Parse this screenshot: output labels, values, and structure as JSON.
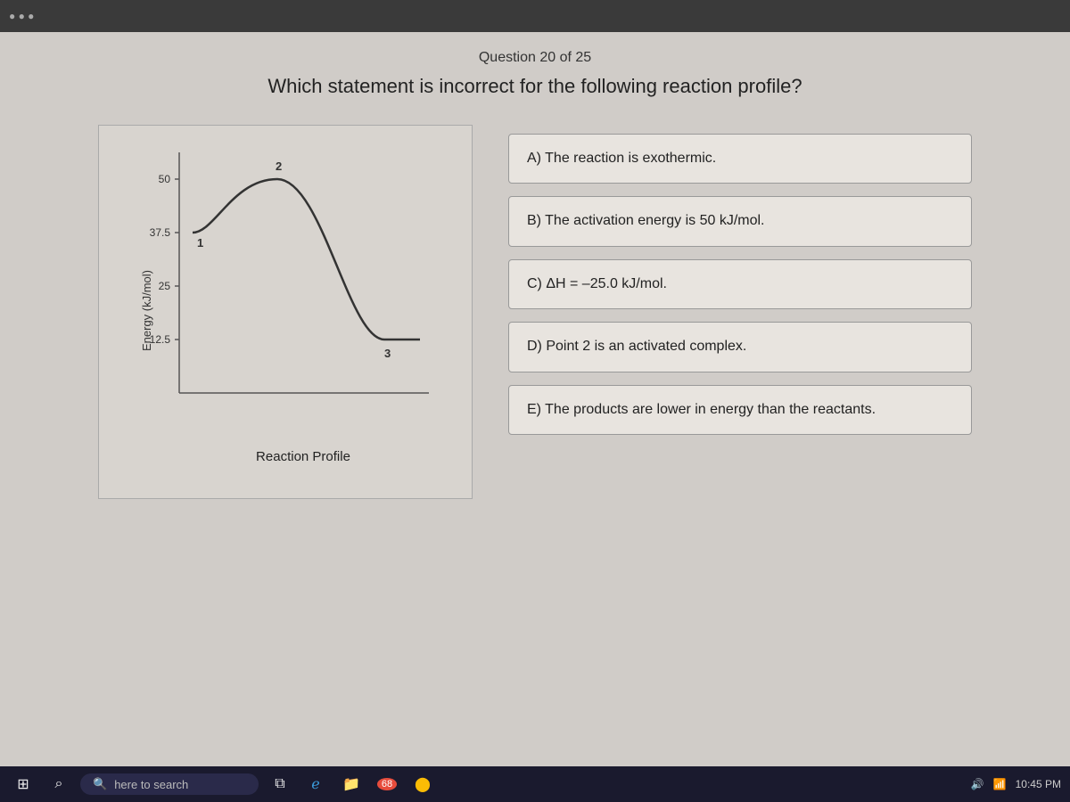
{
  "header": {
    "question_counter": "Question 20 of 25",
    "question_text": "Which statement is incorrect for the following reaction profile?"
  },
  "graph": {
    "title": "Reaction Profile",
    "y_axis_label": "Energy (kJ/mol)",
    "points": {
      "p1_label": "1",
      "p2_label": "2",
      "p3_label": "3"
    },
    "y_values": {
      "v50": "50",
      "v37_5": "37.5",
      "v25": "25",
      "v12_5": "12.5"
    }
  },
  "answers": [
    {
      "id": "A",
      "text": "A) The reaction is exothermic."
    },
    {
      "id": "B",
      "text": "B) The activation energy is 50 kJ/mol."
    },
    {
      "id": "C",
      "text": "C) ΔH = –25.0 kJ/mol."
    },
    {
      "id": "D",
      "text": "D) Point 2 is an activated complex."
    },
    {
      "id": "E",
      "text": "E) The products are lower in energy than the reactants."
    }
  ],
  "taskbar": {
    "search_placeholder": "here to search",
    "notification_num": "68"
  }
}
